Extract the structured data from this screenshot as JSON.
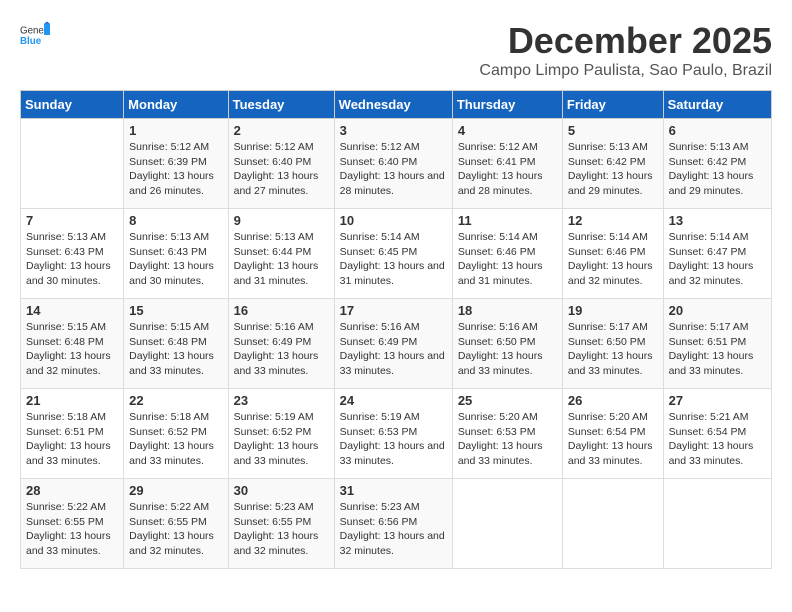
{
  "logo": {
    "general": "General",
    "blue": "Blue"
  },
  "title": "December 2025",
  "location": "Campo Limpo Paulista, Sao Paulo, Brazil",
  "headers": [
    "Sunday",
    "Monday",
    "Tuesday",
    "Wednesday",
    "Thursday",
    "Friday",
    "Saturday"
  ],
  "weeks": [
    [
      {
        "day": "",
        "sunrise": "",
        "sunset": "",
        "daylight": ""
      },
      {
        "day": "1",
        "sunrise": "Sunrise: 5:12 AM",
        "sunset": "Sunset: 6:39 PM",
        "daylight": "Daylight: 13 hours and 26 minutes."
      },
      {
        "day": "2",
        "sunrise": "Sunrise: 5:12 AM",
        "sunset": "Sunset: 6:40 PM",
        "daylight": "Daylight: 13 hours and 27 minutes."
      },
      {
        "day": "3",
        "sunrise": "Sunrise: 5:12 AM",
        "sunset": "Sunset: 6:40 PM",
        "daylight": "Daylight: 13 hours and 28 minutes."
      },
      {
        "day": "4",
        "sunrise": "Sunrise: 5:12 AM",
        "sunset": "Sunset: 6:41 PM",
        "daylight": "Daylight: 13 hours and 28 minutes."
      },
      {
        "day": "5",
        "sunrise": "Sunrise: 5:13 AM",
        "sunset": "Sunset: 6:42 PM",
        "daylight": "Daylight: 13 hours and 29 minutes."
      },
      {
        "day": "6",
        "sunrise": "Sunrise: 5:13 AM",
        "sunset": "Sunset: 6:42 PM",
        "daylight": "Daylight: 13 hours and 29 minutes."
      }
    ],
    [
      {
        "day": "7",
        "sunrise": "Sunrise: 5:13 AM",
        "sunset": "Sunset: 6:43 PM",
        "daylight": "Daylight: 13 hours and 30 minutes."
      },
      {
        "day": "8",
        "sunrise": "Sunrise: 5:13 AM",
        "sunset": "Sunset: 6:43 PM",
        "daylight": "Daylight: 13 hours and 30 minutes."
      },
      {
        "day": "9",
        "sunrise": "Sunrise: 5:13 AM",
        "sunset": "Sunset: 6:44 PM",
        "daylight": "Daylight: 13 hours and 31 minutes."
      },
      {
        "day": "10",
        "sunrise": "Sunrise: 5:14 AM",
        "sunset": "Sunset: 6:45 PM",
        "daylight": "Daylight: 13 hours and 31 minutes."
      },
      {
        "day": "11",
        "sunrise": "Sunrise: 5:14 AM",
        "sunset": "Sunset: 6:46 PM",
        "daylight": "Daylight: 13 hours and 31 minutes."
      },
      {
        "day": "12",
        "sunrise": "Sunrise: 5:14 AM",
        "sunset": "Sunset: 6:46 PM",
        "daylight": "Daylight: 13 hours and 32 minutes."
      },
      {
        "day": "13",
        "sunrise": "Sunrise: 5:14 AM",
        "sunset": "Sunset: 6:47 PM",
        "daylight": "Daylight: 13 hours and 32 minutes."
      }
    ],
    [
      {
        "day": "14",
        "sunrise": "Sunrise: 5:15 AM",
        "sunset": "Sunset: 6:48 PM",
        "daylight": "Daylight: 13 hours and 32 minutes."
      },
      {
        "day": "15",
        "sunrise": "Sunrise: 5:15 AM",
        "sunset": "Sunset: 6:48 PM",
        "daylight": "Daylight: 13 hours and 33 minutes."
      },
      {
        "day": "16",
        "sunrise": "Sunrise: 5:16 AM",
        "sunset": "Sunset: 6:49 PM",
        "daylight": "Daylight: 13 hours and 33 minutes."
      },
      {
        "day": "17",
        "sunrise": "Sunrise: 5:16 AM",
        "sunset": "Sunset: 6:49 PM",
        "daylight": "Daylight: 13 hours and 33 minutes."
      },
      {
        "day": "18",
        "sunrise": "Sunrise: 5:16 AM",
        "sunset": "Sunset: 6:50 PM",
        "daylight": "Daylight: 13 hours and 33 minutes."
      },
      {
        "day": "19",
        "sunrise": "Sunrise: 5:17 AM",
        "sunset": "Sunset: 6:50 PM",
        "daylight": "Daylight: 13 hours and 33 minutes."
      },
      {
        "day": "20",
        "sunrise": "Sunrise: 5:17 AM",
        "sunset": "Sunset: 6:51 PM",
        "daylight": "Daylight: 13 hours and 33 minutes."
      }
    ],
    [
      {
        "day": "21",
        "sunrise": "Sunrise: 5:18 AM",
        "sunset": "Sunset: 6:51 PM",
        "daylight": "Daylight: 13 hours and 33 minutes."
      },
      {
        "day": "22",
        "sunrise": "Sunrise: 5:18 AM",
        "sunset": "Sunset: 6:52 PM",
        "daylight": "Daylight: 13 hours and 33 minutes."
      },
      {
        "day": "23",
        "sunrise": "Sunrise: 5:19 AM",
        "sunset": "Sunset: 6:52 PM",
        "daylight": "Daylight: 13 hours and 33 minutes."
      },
      {
        "day": "24",
        "sunrise": "Sunrise: 5:19 AM",
        "sunset": "Sunset: 6:53 PM",
        "daylight": "Daylight: 13 hours and 33 minutes."
      },
      {
        "day": "25",
        "sunrise": "Sunrise: 5:20 AM",
        "sunset": "Sunset: 6:53 PM",
        "daylight": "Daylight: 13 hours and 33 minutes."
      },
      {
        "day": "26",
        "sunrise": "Sunrise: 5:20 AM",
        "sunset": "Sunset: 6:54 PM",
        "daylight": "Daylight: 13 hours and 33 minutes."
      },
      {
        "day": "27",
        "sunrise": "Sunrise: 5:21 AM",
        "sunset": "Sunset: 6:54 PM",
        "daylight": "Daylight: 13 hours and 33 minutes."
      }
    ],
    [
      {
        "day": "28",
        "sunrise": "Sunrise: 5:22 AM",
        "sunset": "Sunset: 6:55 PM",
        "daylight": "Daylight: 13 hours and 33 minutes."
      },
      {
        "day": "29",
        "sunrise": "Sunrise: 5:22 AM",
        "sunset": "Sunset: 6:55 PM",
        "daylight": "Daylight: 13 hours and 32 minutes."
      },
      {
        "day": "30",
        "sunrise": "Sunrise: 5:23 AM",
        "sunset": "Sunset: 6:55 PM",
        "daylight": "Daylight: 13 hours and 32 minutes."
      },
      {
        "day": "31",
        "sunrise": "Sunrise: 5:23 AM",
        "sunset": "Sunset: 6:56 PM",
        "daylight": "Daylight: 13 hours and 32 minutes."
      },
      {
        "day": "",
        "sunrise": "",
        "sunset": "",
        "daylight": ""
      },
      {
        "day": "",
        "sunrise": "",
        "sunset": "",
        "daylight": ""
      },
      {
        "day": "",
        "sunrise": "",
        "sunset": "",
        "daylight": ""
      }
    ]
  ]
}
